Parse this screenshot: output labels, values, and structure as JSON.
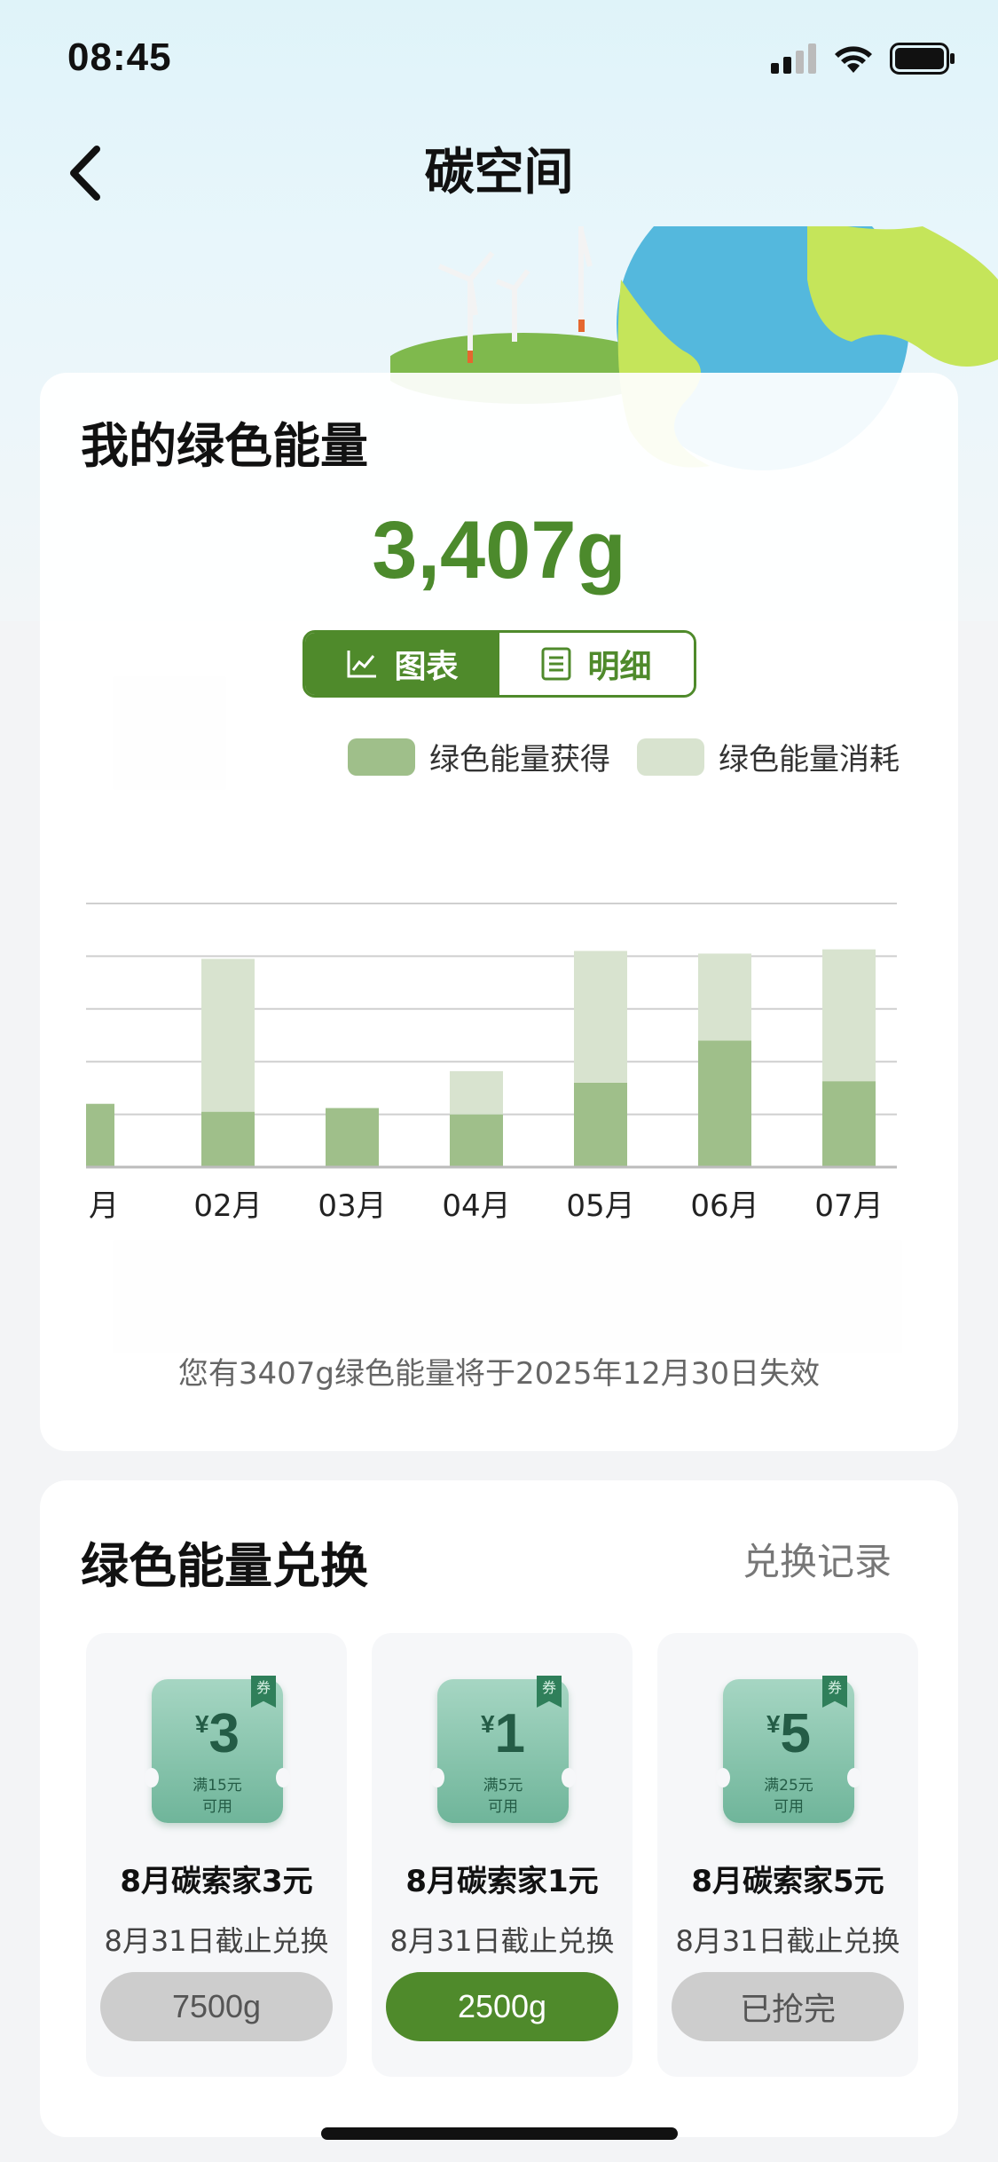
{
  "status_bar": {
    "time": "08:45"
  },
  "nav": {
    "title": "碳空间"
  },
  "energy": {
    "title": "我的绿色能量",
    "total": "3,407g",
    "toggle": {
      "chart_label": "图表",
      "detail_label": "明细"
    },
    "legend": {
      "gained": "绿色能量获得",
      "consumed": "绿色能量消耗"
    },
    "expire_note": "您有3407g绿色能量将于2025年12月30日失效"
  },
  "colors": {
    "accent": "#4f8a2b",
    "gained": "#9fbf8a",
    "consumed": "#d8e3cf",
    "voucher": "#7fbfa5"
  },
  "chart_data": {
    "type": "bar",
    "stacked": true,
    "categories": [
      "月",
      "02月",
      "03月",
      "04月",
      "05月",
      "06月",
      "07月"
    ],
    "series": [
      {
        "name": "绿色能量获得",
        "values": [
          1.2,
          1.05,
          1.12,
          1.0,
          1.6,
          2.4,
          1.63
        ]
      },
      {
        "name": "绿色能量消耗",
        "values": [
          0,
          2.9,
          0,
          0.82,
          2.5,
          1.65,
          2.5
        ]
      }
    ],
    "ylim": [
      0,
      5
    ],
    "grid": true,
    "legend": "top-right"
  },
  "exchange": {
    "title": "绿色能量兑换",
    "record_link": "兑换记录",
    "vouchers": [
      {
        "yen": "¥",
        "amount": "3",
        "condition": "满15元",
        "usable": "可用",
        "tag": "券",
        "name": "8月碳索家3元",
        "deadline": "8月31日截止兑换",
        "button": "7500g"
      },
      {
        "yen": "¥",
        "amount": "1",
        "condition": "满5元",
        "usable": "可用",
        "tag": "券",
        "name": "8月碳索家1元",
        "deadline": "8月31日截止兑换",
        "button": "2500g"
      },
      {
        "yen": "¥",
        "amount": "5",
        "condition": "满25元",
        "usable": "可用",
        "tag": "券",
        "name": "8月碳索家5元",
        "deadline": "8月31日截止兑换",
        "button": "已抢完"
      }
    ]
  }
}
